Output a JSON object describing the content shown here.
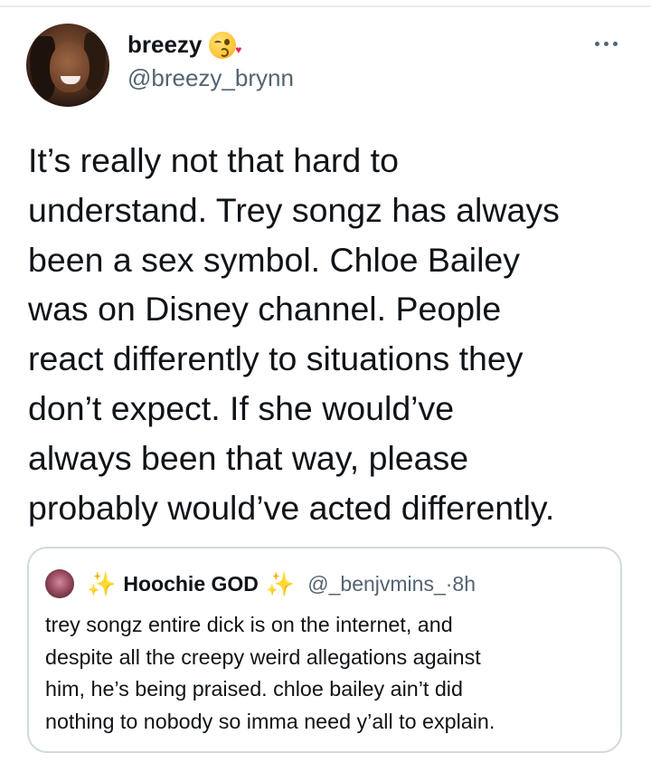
{
  "tweet": {
    "author": {
      "display_name": "breezy",
      "name_emoji": "kissing-face-emoji",
      "handle": "@breezy_brynn",
      "avatar": "profile-photo"
    },
    "text": "It’s really not that hard to\nunderstand. Trey songz has always\nbeen a sex symbol. Chloe Bailey\nwas on Disney channel. People\nreact differently to situations they\ndon’t expect. If she would’ve\nalways been that way, please\nprobably would’ve acted differently."
  },
  "quote": {
    "author": {
      "display_name": "Hoochie GOD",
      "decoration": "sparkles-emoji",
      "handle": "@_benjvmins_",
      "separator": " · ",
      "time": "8h"
    },
    "text": "trey songz entire dick is on the internet, and\ndespite all the creepy weird allegations against\nhim, he’s being praised. chloe bailey ain’t did\nnothing to nobody so imma need y’all to explain."
  },
  "colors": {
    "text_primary": "#0f1419",
    "text_secondary": "#536471",
    "border": "#cfd9de"
  }
}
